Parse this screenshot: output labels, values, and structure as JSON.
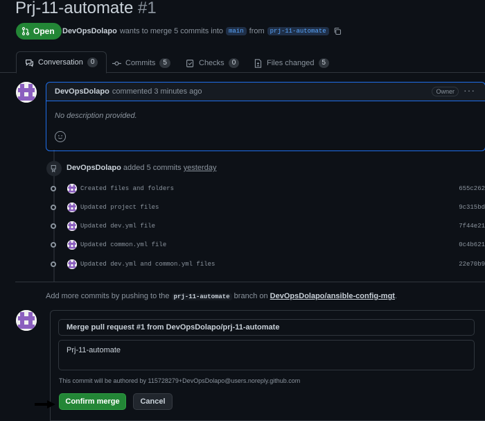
{
  "header": {
    "title": "Prj-11-automate",
    "number": "#1",
    "state": "Open",
    "author": "DevOpsDolapo",
    "merge_text": "wants to merge 5 commits into",
    "base_branch": "main",
    "from_text": "from",
    "head_branch": "prj-11-automate"
  },
  "tabs": [
    {
      "label": "Conversation",
      "count": "0"
    },
    {
      "label": "Commits",
      "count": "5"
    },
    {
      "label": "Checks",
      "count": "0"
    },
    {
      "label": "Files changed",
      "count": "5"
    }
  ],
  "comment": {
    "author": "DevOpsDolapo",
    "action": "commented 3 minutes ago",
    "badge": "Owner",
    "body": "No description provided."
  },
  "commits_event": {
    "author": "DevOpsDolapo",
    "action": "added 5 commits",
    "when": "yesterday"
  },
  "commits": [
    {
      "message": "Created files and folders",
      "sha": "655c262"
    },
    {
      "message": "Updated project files",
      "sha": "9c315bd"
    },
    {
      "message": "Updated dev.yml file",
      "sha": "7f44e21"
    },
    {
      "message": "Updated common.yml file",
      "sha": "0c4b621"
    },
    {
      "message": "Updated dev.yml and common.yml files",
      "sha": "22e70b9"
    }
  ],
  "hint": {
    "prefix": "Add more commits by pushing to the",
    "branch": "prj-11-automate",
    "middle": "branch on",
    "repo": "DevOpsDolapo/ansible-config-mgt",
    "suffix": "."
  },
  "merge": {
    "title_value": "Merge pull request #1 from DevOpsDolapo/prj-11-automate",
    "body_value": "Prj-11-automate",
    "authored_note": "This commit will be authored by 115728279+DevOpsDolapo@users.noreply.github.com",
    "confirm_label": "Confirm merge",
    "cancel_label": "Cancel"
  },
  "colors": {
    "accent_green": "#238636",
    "avatar_purple": "#8b5fbf"
  }
}
